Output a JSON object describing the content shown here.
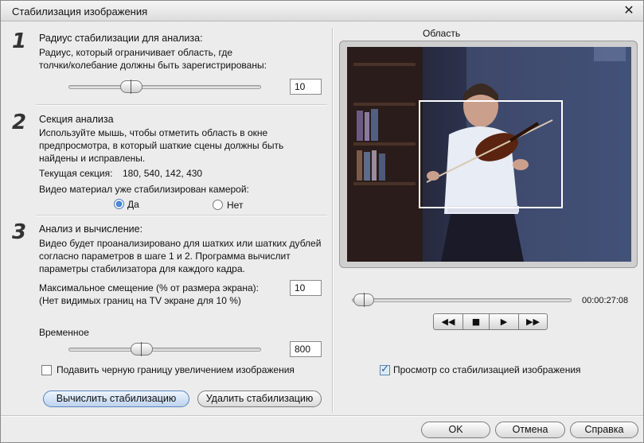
{
  "window": {
    "title": "Стабилизация изображения"
  },
  "step1": {
    "number": "1",
    "heading": "Радиус стабилизации для анализа:",
    "desc_line1": "Радиус, который ограничивает область, где",
    "desc_line2": "толчки/колебание должны быть зарегистрированы:",
    "slider_value": 0.3,
    "value": "10"
  },
  "step2": {
    "number": "2",
    "heading": "Секция анализа",
    "desc_line1": "Используйте мышь, чтобы отметить область в окне",
    "desc_line2": "предпросмотра, в который шаткие сцены должны быть",
    "desc_line3": "найдены и исправлены.",
    "section_label": "Текущая секция:",
    "section_value": "180, 540, 142, 430",
    "stabilized_question": "Видео материал уже стабилизирован камерой:",
    "radio_yes": "Да",
    "radio_no": "Нет",
    "selected": "yes"
  },
  "step3": {
    "number": "3",
    "heading": "Анализ и вычисление:",
    "desc_line1": "Видео будет проанализировано для шатких или шатких дублей",
    "desc_line2": "согласно параметров в шаге 1 и 2. Программа вычислит",
    "desc_line3": "параметры стабилизатора для каждого кадра.",
    "max_shift_label": "Максимальное смещение (% от размера экрана):",
    "max_shift_note": "(Нет видимых границ на TV экране для 10 %)",
    "max_shift_value": "10",
    "temporal_label": "Временное",
    "temporal_slider_value": 0.31,
    "temporal_value": "800",
    "suppress_border_label": "Подавить черную границу увеличением изображения",
    "suppress_border_checked": false,
    "compute_button": "Вычислить стабилизацию",
    "remove_button": "Удалить стабилизацию"
  },
  "preview": {
    "label": "Область",
    "timecode": "00:00:27:08",
    "scrub_position": 0.0,
    "controls": [
      "rewind-icon",
      "stop-icon",
      "play-icon",
      "fast-forward-icon"
    ],
    "stabilized_preview_label": "Просмотр со стабилизацией изображения",
    "stabilized_preview_checked": true
  },
  "footer": {
    "ok": "OK",
    "cancel": "Отмена",
    "help": "Справка"
  },
  "colors": {
    "window_bg": "#ececec",
    "primary_button": "#bcd3ee",
    "radio_selected": "#3a79c8"
  }
}
